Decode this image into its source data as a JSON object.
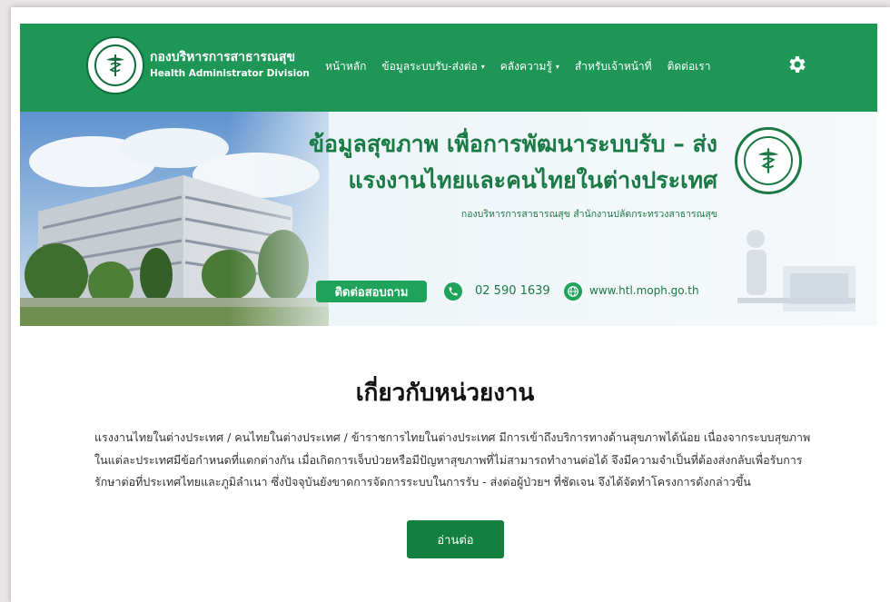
{
  "brand": {
    "name_th": "กองบริหารการสาธารณสุข",
    "name_en": "Health Administrator Division",
    "logo_icon": "ministry-seal-icon"
  },
  "nav": {
    "items": [
      {
        "label": "หน้าหลัก",
        "has_dropdown": false
      },
      {
        "label": "ข้อมูลระบบรับ-ส่งต่อ",
        "has_dropdown": true
      },
      {
        "label": "คลังความรู้",
        "has_dropdown": true
      },
      {
        "label": "สำหรับเจ้าหน้าที่",
        "has_dropdown": false
      },
      {
        "label": "ติดต่อเรา",
        "has_dropdown": false
      }
    ],
    "settings_icon": "gear-icon"
  },
  "banner": {
    "title_line1": "ข้อมูลสุขภาพ เพื่อการพัฒนาระบบรับ – ส่ง",
    "title_line2": "แรงงานไทยและคนไทยในต่างประเทศ",
    "subtitle": "กองบริหารการสาธารณสุข สำนักงานปลัดกระทรวงสาธารณสุข",
    "contact_label": "ติดต่อสอบถาม",
    "phone": "02 590 1639",
    "website": "www.htl.moph.go.th"
  },
  "about": {
    "heading": "เกี่ยวกับหน่วยงาน",
    "body": "แรงงานไทยในต่างประเทศ / คนไทยในต่างประเทศ / ข้าราชการไทยในต่างประเทศ มีการเข้าถึงบริการทางด้านสุขภาพได้น้อย เนื่องจากระบบสุขภาพในแต่ละประเทศมีข้อกำหนดที่แตกต่างกัน เมื่อเกิดการเจ็บป่วยหรือมีปัญหาสุขภาพที่ไม่สามารถทำงานต่อได้ จึงมีความจำเป็นที่ต้องส่งกลับเพื่อรับการรักษาต่อที่ประเทศไทยและภูมิลำเนา ซึ่งปัจจุบันยังขาดการจัดการระบบในการรับ - ส่งต่อผู้ป่วยฯ ที่ชัดเจน จึงได้จัดทำโครงการดังกล่าวขึ้น",
    "read_more": "อ่านต่อ"
  },
  "colors": {
    "primary": "#1d9656",
    "dark_green": "#13803f",
    "title_green": "#1a7a45"
  }
}
